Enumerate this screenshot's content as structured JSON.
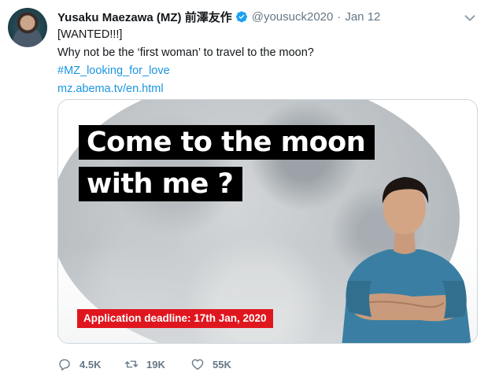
{
  "author": {
    "display_name": "Yusaku Maezawa (MZ) 前澤友作",
    "handle": "@yousuck2020",
    "separator": "·",
    "date": "Jan 12"
  },
  "tweet": {
    "line1": "[WANTED!!!]",
    "line2": "Why not be the ‘first woman’ to travel to the moon?",
    "hashtag": "#MZ_looking_for_love",
    "url": "mz.abema.tv/en.html"
  },
  "media": {
    "headline_line1": "Come to the moon",
    "headline_line2": "with me ?",
    "deadline": "Application deadline: 17th Jan, 2020"
  },
  "actions": {
    "replies": "4.5K",
    "retweets": "19K",
    "likes": "55K"
  },
  "colors": {
    "link": "#1b95e0",
    "verified": "#1da1f2",
    "muted": "#657786",
    "deadline_bg": "#e0161f"
  },
  "icons": {
    "verified": "verified-badge-icon",
    "menu": "chevron-down-icon",
    "reply": "reply-icon",
    "retweet": "retweet-icon",
    "like": "heart-icon"
  }
}
